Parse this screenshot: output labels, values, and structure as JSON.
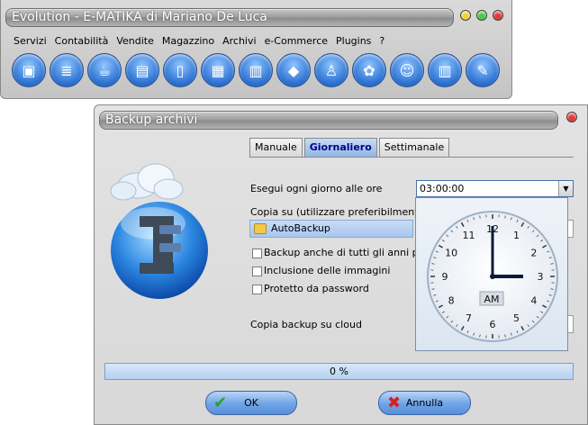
{
  "main_window": {
    "title": "Evolution - E-MATIKA di Mariano De Luca",
    "menu": [
      "Servizi",
      "Contabilità",
      "Vendite",
      "Magazzino",
      "Archivi",
      "e-Commerce",
      "Plugins",
      "?"
    ],
    "toolbar_icons": [
      "disk-icon",
      "database-icon",
      "cup-icon",
      "books-icon",
      "document-icon",
      "calendar-icon",
      "form-icon",
      "shapes-icon",
      "worker-icon",
      "plant-icon",
      "people-icon",
      "buildings-icon",
      "wrench-icon"
    ]
  },
  "dialog": {
    "title": "Backup archivi",
    "tabs": {
      "manuale": "Manuale",
      "giornaliero": "Giornaliero",
      "settimanale": "Settimanale"
    },
    "daily_label": "Esegui ogni giorno alle ore",
    "time_value": "03:00:00",
    "copy_label": "Copia su (utilizzare preferibilmente un",
    "folder": "AutoBackup",
    "chk_years": "Backup anche di tutti gli anni prece",
    "chk_images": "Inclusione delle immagini",
    "chk_password": "Protetto da password",
    "cloud_label": "Copia backup su cloud",
    "progress": "0 %",
    "progress_value": 0,
    "ok": "OK",
    "cancel": "Annulla"
  },
  "clock": {
    "numbers": [
      "12",
      "1",
      "2",
      "3",
      "4",
      "5",
      "6",
      "7",
      "8",
      "9",
      "10",
      "11"
    ],
    "ampm": "AM",
    "hour": 3,
    "minute": 0
  }
}
